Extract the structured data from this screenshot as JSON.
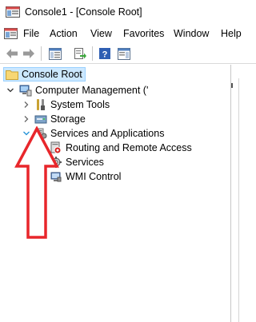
{
  "window": {
    "title": "Console1 - [Console Root]"
  },
  "menu": {
    "items": [
      "File",
      "Action",
      "View",
      "Favorites",
      "Window",
      "Help"
    ]
  },
  "toolbar": {
    "buttons": [
      "back-icon",
      "forward-icon",
      "show-hide-console-tree-icon",
      "export-list-icon",
      "help-icon",
      "show-hide-action-pane-icon"
    ]
  },
  "tree": {
    "root": "Console Root",
    "computer_management": "Computer Management ('",
    "system_tools": "System Tools",
    "storage": "Storage",
    "services_and_applications": "Services and Applications",
    "routing_and_remote_access": "Routing and Remote Access",
    "services": "Services",
    "wmi_control": "WMI Control"
  },
  "colors": {
    "selection": "#cce8ff",
    "selection_border": "#99d1ff",
    "expander_open": "#1e8fd6",
    "arrow": "#e8262b"
  }
}
